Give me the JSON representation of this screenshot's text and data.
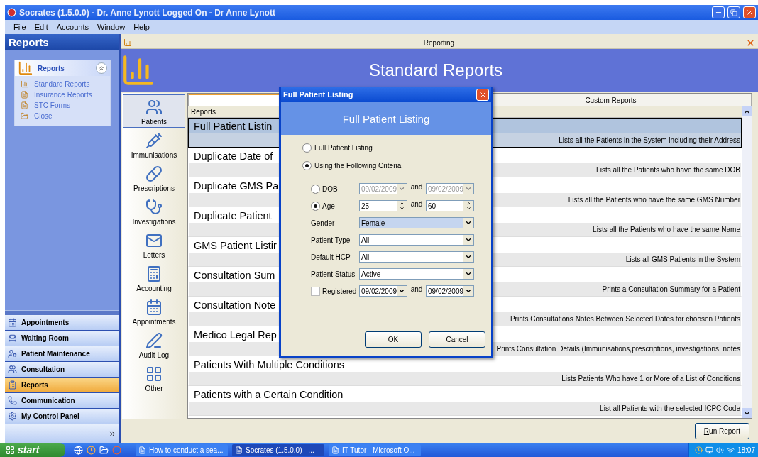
{
  "window": {
    "title": "Socrates (1.5.0.0) - Dr. Anne Lynott Logged On - Dr Anne Lynott"
  },
  "menu": [
    {
      "label": "File",
      "mnemonic": true
    },
    {
      "label": "Edit",
      "mnemonic": true
    },
    {
      "label": "Accounts",
      "mnemonic": false
    },
    {
      "label": "Window",
      "mnemonic": true
    },
    {
      "label": "Help",
      "mnemonic": true
    }
  ],
  "sidebar": {
    "title": "Reports",
    "group": {
      "title": "Reports",
      "expanded": true,
      "items": [
        "Standard Reports",
        "Insurance Reports",
        "STC Forms",
        "Close"
      ]
    },
    "nav": [
      {
        "label": "Appointments",
        "selected": false
      },
      {
        "label": "Waiting Room",
        "selected": false
      },
      {
        "label": "Patient Maintenance",
        "selected": false
      },
      {
        "label": "Consultation",
        "selected": false
      },
      {
        "label": "Reports",
        "selected": true
      },
      {
        "label": "Communication",
        "selected": false
      },
      {
        "label": "My Control Panel",
        "selected": false
      }
    ]
  },
  "main": {
    "strip_title": "Reporting",
    "banner_title": "Standard Reports",
    "categories": [
      {
        "label": "Patients",
        "selected": true
      },
      {
        "label": "Immunisations",
        "selected": false
      },
      {
        "label": "Prescriptions",
        "selected": false
      },
      {
        "label": "Investigations",
        "selected": false
      },
      {
        "label": "Letters",
        "selected": false
      },
      {
        "label": "Accounting",
        "selected": false
      },
      {
        "label": "Appointments",
        "selected": false
      },
      {
        "label": "Audit Log",
        "selected": false
      },
      {
        "label": "Other",
        "selected": false
      }
    ],
    "tabs": [
      {
        "selected": true
      },
      {
        "label": "Custom Reports",
        "selected": false
      }
    ],
    "column": "Reports",
    "reports": [
      {
        "title": "Full Patient Listin",
        "description": "Lists all the Patients in the System including their Address",
        "selected": true
      },
      {
        "title": "Duplicate Date of",
        "description": "Lists all the Patients who have the same DOB",
        "selected": false
      },
      {
        "title": "Duplicate GMS Pa",
        "description": "Lists all the Patients who have the same GMS Number",
        "selected": false
      },
      {
        "title": "Duplicate Patient",
        "description": "Lists all the Patients who have the same Name",
        "selected": false
      },
      {
        "title": "GMS Patient Listir",
        "description": "Lists all GMS Patients in the System",
        "selected": false
      },
      {
        "title": "Consultation Sum",
        "description": "Prints a Consultation Summary for a Patient",
        "selected": false
      },
      {
        "title": "Consultation Note",
        "description": "Prints Consultations Notes Between Selected Dates for choosen Patients",
        "selected": false
      },
      {
        "title": "Medico Legal Rep",
        "description": "Prints Consultation Details (Immunisations,prescriptions, investigations, notes",
        "selected": false
      },
      {
        "title": "Patients With Multiple Conditions",
        "description": "Lists Patients Who have 1 or More of a List of Conditions",
        "selected": false
      },
      {
        "title": "Patients with a Certain Condition",
        "description": "List all Patients with the selected ICPC Code",
        "selected": false
      }
    ],
    "run_button": {
      "label": "Run Report",
      "mnemonic": true
    }
  },
  "dialog": {
    "title": "Full Patient Listing",
    "header": "Full Patient Listing",
    "options": [
      {
        "label": "Full Patient Listing",
        "selected": false
      },
      {
        "label": "Using the Following Criteria",
        "selected": true
      }
    ],
    "criteria": [
      {
        "kind": "radio-dates",
        "label": "DOB",
        "selected": false,
        "disabled": true,
        "from": "09/02/2009",
        "joiner": "and",
        "to": "09/02/2009"
      },
      {
        "kind": "radio-spins",
        "label": "Age",
        "selected": true,
        "from": "25",
        "joiner": "and",
        "to": "60"
      },
      {
        "kind": "select",
        "label": "Gender",
        "value": "Female",
        "focused": true
      },
      {
        "kind": "select",
        "label": "Patient Type",
        "value": "All",
        "focused": false
      },
      {
        "kind": "select",
        "label": "Default HCP",
        "value": "All",
        "focused": false
      },
      {
        "kind": "select",
        "label": "Patient Status",
        "value": "Active",
        "focused": false
      },
      {
        "kind": "check-dates",
        "label": "Registered",
        "checked": false,
        "from": "09/02/2009",
        "joiner": "and",
        "to": "09/02/2009"
      }
    ],
    "buttons": [
      {
        "label": "OK",
        "mnemonic": true
      },
      {
        "label": "Cancel",
        "mnemonic": true
      }
    ]
  },
  "taskbar": {
    "start": "start",
    "windows": [
      {
        "label": "How to conduct a sea...",
        "selected": false
      },
      {
        "label": "Socrates (1.5.0.0) - ...",
        "selected": true
      },
      {
        "label": "IT Tutor - Microsoft O...",
        "selected": false
      }
    ],
    "time": "18:07"
  }
}
